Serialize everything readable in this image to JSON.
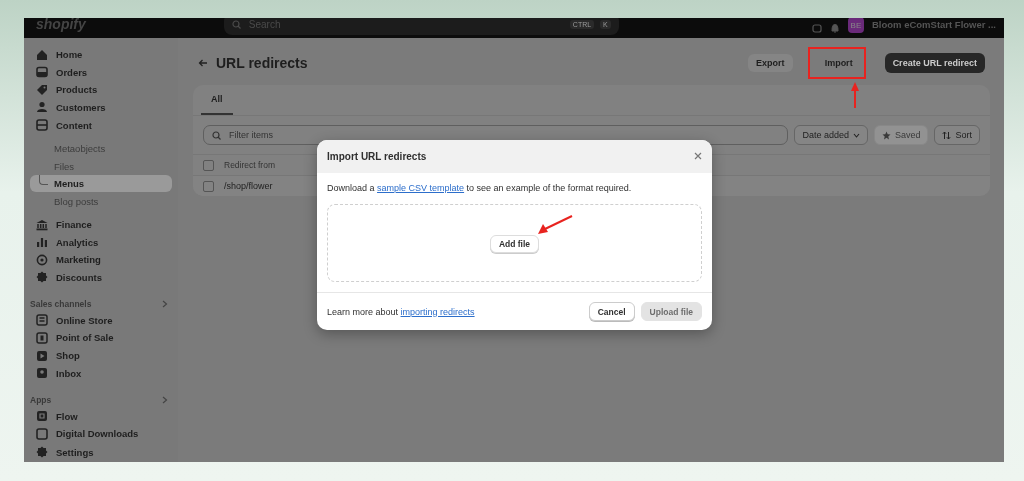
{
  "topbar": {
    "logo": "shopify",
    "search": {
      "placeholder": "Search"
    },
    "shortcut": [
      "CTRL",
      "K"
    ],
    "avatar": "BE",
    "store": "Bloom eComStart Flower ..."
  },
  "sidebar": {
    "items": [
      {
        "label": "Home",
        "selected": false
      },
      {
        "label": "Orders",
        "selected": false
      },
      {
        "label": "Products",
        "selected": false
      },
      {
        "label": "Customers",
        "selected": false
      },
      {
        "label": "Content",
        "selected": false,
        "expanded": true,
        "children": [
          {
            "label": "Metaobjects",
            "selected": false
          },
          {
            "label": "Files",
            "selected": false
          },
          {
            "label": "Menus",
            "selected": true
          },
          {
            "label": "Blog posts",
            "selected": false
          }
        ]
      },
      {
        "label": "Finance",
        "selected": false
      },
      {
        "label": "Analytics",
        "selected": false
      },
      {
        "label": "Marketing",
        "selected": false
      },
      {
        "label": "Discounts",
        "selected": false
      }
    ],
    "sections": [
      {
        "title": "Sales channels",
        "items": [
          {
            "label": "Online Store",
            "selected": false
          },
          {
            "label": "Point of Sale",
            "selected": false
          },
          {
            "label": "Shop",
            "selected": false
          },
          {
            "label": "Inbox",
            "selected": false
          }
        ]
      },
      {
        "title": "Apps",
        "items": [
          {
            "label": "Flow",
            "selected": false
          },
          {
            "label": "Digital Downloads",
            "selected": false
          }
        ]
      }
    ],
    "settings": "Settings"
  },
  "page": {
    "title": "URL redirects",
    "actions": [
      {
        "label": "Export",
        "kind": "secondary",
        "highlighted": false
      },
      {
        "label": "Import",
        "kind": "plain",
        "highlighted": true
      },
      {
        "label": "Create URL redirect",
        "kind": "primary",
        "highlighted": false
      }
    ],
    "tabs": [
      {
        "label": "All",
        "selected": true
      }
    ],
    "filter": {
      "placeholder": "Filter items"
    },
    "sort_by": "Date added",
    "saved": {
      "label": "Saved",
      "disabled": true
    },
    "sort": "Sort",
    "table": {
      "columns": [
        "Redirect from"
      ],
      "rows": [
        {
          "cells": [
            "/shop/flower"
          ],
          "checked": false
        }
      ],
      "all_checked": false
    }
  },
  "modal": {
    "title": "Import URL redirects",
    "text_before": "Download a ",
    "link": "sample CSV template",
    "text_after": " to see an example of the format required.",
    "add_file": "Add file",
    "footer_text": "Learn more about ",
    "footer_link": "importing redirects",
    "buttons": [
      {
        "label": "Cancel",
        "disabled": false
      },
      {
        "label": "Upload file",
        "disabled": true
      }
    ]
  }
}
